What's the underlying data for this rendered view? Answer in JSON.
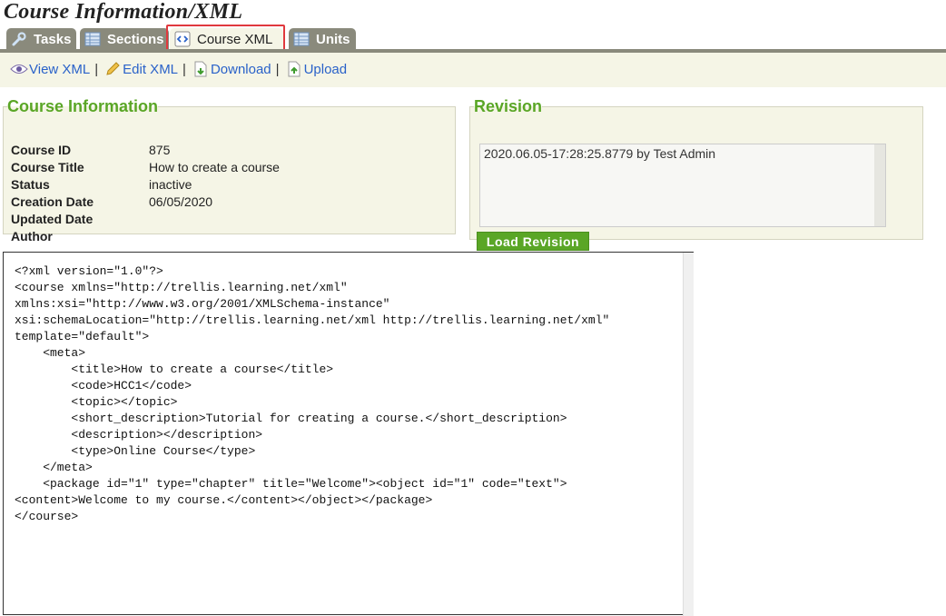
{
  "page": {
    "title": "Course Information/XML"
  },
  "tabs": [
    {
      "label": "Tasks",
      "icon": "wrench-icon",
      "active": false
    },
    {
      "label": "Sections",
      "icon": "table-icon",
      "active": false
    },
    {
      "label": "Course XML",
      "icon": "code-icon",
      "active": true
    },
    {
      "label": "Units",
      "icon": "table-icon",
      "active": false
    }
  ],
  "actions": {
    "view_xml": "View XML",
    "edit_xml": "Edit XML",
    "download": "Download",
    "upload": "Upload",
    "separator": "|"
  },
  "course_info": {
    "heading": "Course Information",
    "rows": [
      {
        "label": "Course ID",
        "value": "875"
      },
      {
        "label": "Course Title",
        "value": "How to create a course"
      },
      {
        "label": "Status",
        "value": "inactive"
      },
      {
        "label": "Creation Date",
        "value": "06/05/2020"
      },
      {
        "label": "Updated Date",
        "value": ""
      },
      {
        "label": "Author",
        "value": ""
      }
    ]
  },
  "revision": {
    "heading": "Revision",
    "selected": "2020.06.05-17:28:25.8779 by Test Admin",
    "load_button": "Load Revision"
  },
  "xml": {
    "content": "<?xml version=\"1.0\"?>\n<course xmlns=\"http://trellis.learning.net/xml\"\nxmlns:xsi=\"http://www.w3.org/2001/XMLSchema-instance\"\nxsi:schemaLocation=\"http://trellis.learning.net/xml http://trellis.learning.net/xml\"\ntemplate=\"default\">\n    <meta>\n        <title>How to create a course</title>\n        <code>HCC1</code>\n        <topic></topic>\n        <short_description>Tutorial for creating a course.</short_description>\n        <description></description>\n        <type>Online Course</type>\n    </meta>\n    <package id=\"1\" type=\"chapter\" title=\"Welcome\"><object id=\"1\" code=\"text\">\n<content>Welcome to my course.</content></object></package>\n</course>"
  },
  "colors": {
    "accent_green": "#5aa626",
    "tab_gray": "#8a8a7c",
    "panel_bg": "#f5f5e6",
    "link_blue": "#2a62c9",
    "highlight_red": "#e0393e"
  }
}
